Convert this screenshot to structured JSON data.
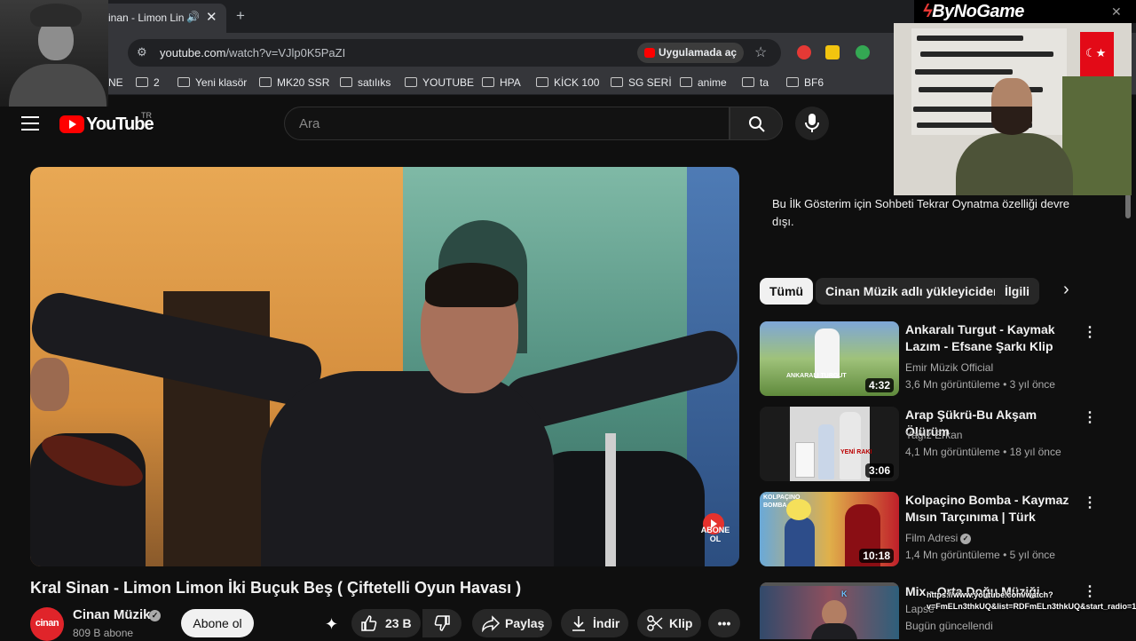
{
  "browser": {
    "tab_title": "inan - Limon Lin",
    "url_host": "youtube.com",
    "url_path": "/watch?v=VJlp0K5PaZI",
    "open_in_app": "Uygulamada aç",
    "bookmarks": [
      "NE",
      "2",
      "Yeni klasör",
      "MK20 SSR",
      "satılıks",
      "YOUTUBE",
      "HPA",
      "KİCK 100",
      "SG SERİ",
      "anime",
      "ta",
      "BF6"
    ]
  },
  "stream_overlay": {
    "brand": "ByNoGame",
    "chat_user": "K",
    "chat_url": "https://www.youtube.com/watch?v=FmELn3thkUQ&list=RDFmELn3thkUQ&start_radio=1"
  },
  "header": {
    "logo_text": "YouTube",
    "country": "TR",
    "search_placeholder": "Ara"
  },
  "video": {
    "title": "Kral Sinan - Limon Limon İki Buçuk Beş ( Çiftetelli Oyun Havası )",
    "channel": "Cinan Müzik",
    "avatar_text": "cinan",
    "subscribers": "809 B abone",
    "subscribe_label": "Abone ol",
    "likes": "23 B",
    "share_label": "Paylaş",
    "download_label": "İndir",
    "clip_label": "Klip",
    "overlay_badge": "ABONE OL"
  },
  "sidebar": {
    "chat_notice": "Bu İlk Gösterim için Sohbeti Tekrar Oynatma özelliği devre dışı.",
    "chips": [
      "Tümü",
      "Cinan Müzik adlı yükleyiciden",
      "İlgili"
    ],
    "recommendations": [
      {
        "title": "Ankaralı Turgut - Kaymak Lazım - Efsane Şarkı Klip",
        "channel": "Emir Müzik Official",
        "meta": "3,6 Mn görüntüleme • 3 yıl önce",
        "duration": "4:32",
        "thumb_text": "ANKARALI TURGUT",
        "verified": false
      },
      {
        "title": "Arap Şükrü-Bu Akşam Ölürüm",
        "channel": "Yağız Erkan",
        "meta": "4,1 Mn görüntüleme • 18 yıl önce",
        "duration": "3:06",
        "thumb_text": "YENİ RAKI",
        "verified": false
      },
      {
        "title": "Kolpaçino Bomba - Kaymaz Mısın Tarçınıma | Türk Komedi...",
        "channel": "Film Adresi",
        "meta": "1,4 Mn görüntüleme • 5 yıl önce",
        "duration": "10:18",
        "thumb_text": "KOLPAÇINO BOMBA",
        "verified": true
      },
      {
        "title": "Mix - Orta Doğu Müziği",
        "channel": "Lapse",
        "meta": "Bugün güncellendi",
        "duration": "",
        "thumb_text": "",
        "verified": false
      }
    ]
  }
}
